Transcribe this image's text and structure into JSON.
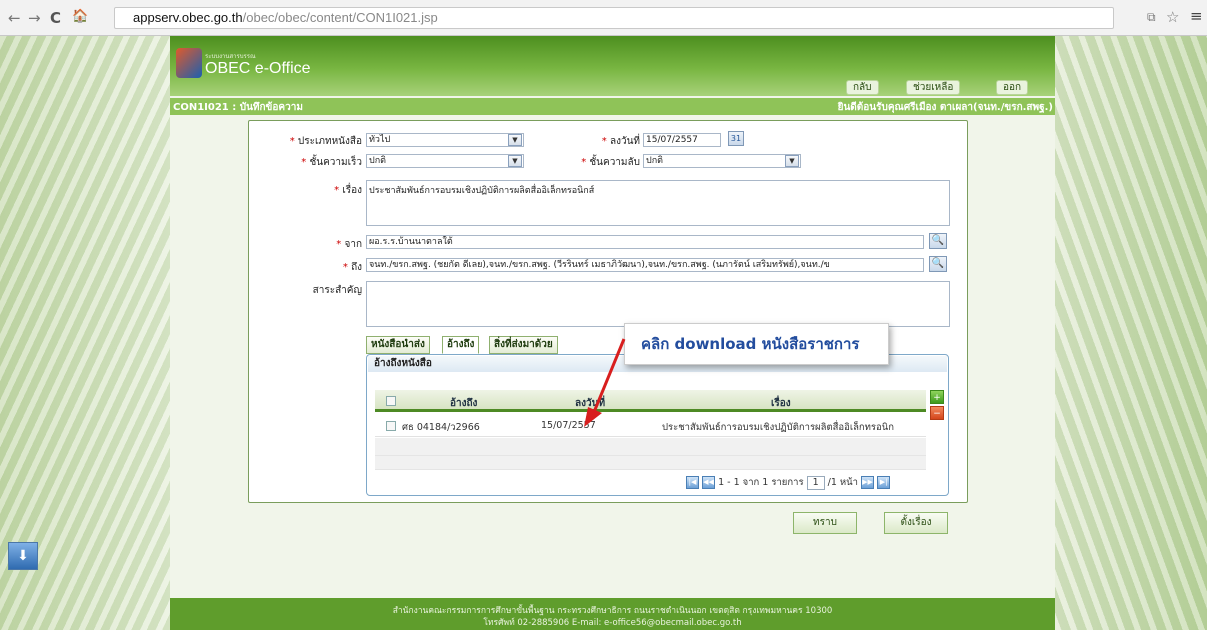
{
  "browser": {
    "url_host": "appserv.obec.go.th",
    "url_path": "/obec/obec/content/CON1I021.jsp",
    "back": "←",
    "forward": "→",
    "reload": "C",
    "home": "🏠",
    "menu": "≡",
    "star": "☆",
    "ext": "⧉"
  },
  "header": {
    "subtitle": "ระบบงานสารบรรณ",
    "title": "OBEC e-Office",
    "buttons": [
      "กลับ",
      "ช่วยเหลือ",
      "ออก"
    ]
  },
  "crumb": "CON1I021 : บันทึกข้อความ",
  "user_info": "ยินดีต้อนรับคุณศรีเมือง ตาเผลา(จนท./ขรก.สพฐ.)",
  "form": {
    "doc_type_label": "ประเภทหนังสือ",
    "doc_type_value": "ทั่วไป",
    "date_label": "ลงวันที่",
    "date_value": "15/07/2557",
    "urgency_label": "ชั้นความเร็ว",
    "urgency_value": "ปกติ",
    "secrecy_label": "ชั้นความลับ",
    "secrecy_value": "ปกติ",
    "subject_label": "เรื่อง",
    "subject_value": "ประชาสัมพันธ์การอบรมเชิงปฏิบัติการผลิตสื่ออิเล็กทรอนิกส์",
    "from_label": "จาก",
    "from_value": "ผอ.ร.ร.บ้านนาตาลใต้",
    "to_label": "ถึง",
    "to_value": "จนท./ขรก.สพฐ. (ชยกัต ดีเลย),จนท./ขรก.สพฐ. (วีรรินทร์ เมธาภิวัฒนา),จนท./ขรก.สพฐ. (นภารัตน์ เสริมทรัพย์),จนท./ข",
    "summary_label": "สาระสำคัญ"
  },
  "tabs": [
    "หนังสือนำส่ง",
    "อ้างถึง",
    "สิ่งที่ส่งมาด้วย"
  ],
  "grid": {
    "title": "อ้างถึงหนังสือ",
    "columns": [
      "อ้างถึง",
      "ลงวันที่",
      "เรื่อง"
    ],
    "rows": [
      {
        "ref": "ศธ 04184/ว2966",
        "date": "15/07/2557",
        "subject": "ประชาสัมพันธ์การอบรมเชิงปฏิบัติการผลิตสื่ออิเล็กทรอนิก"
      }
    ],
    "pager_text": "1 - 1 จาก 1 รายการ",
    "page": "1",
    "page_total": "/1 หน้า"
  },
  "callout": "คลิก download หนังสือราชการ",
  "actions": [
    "ทราบ",
    "ตั้งเรื่อง"
  ],
  "footer": {
    "line1": "สำนักงานคณะกรรมการการศึกษาขั้นพื้นฐาน กระทรวงศึกษาธิการ ถนนราชดำเนินนอก เขตดุสิต กรุงเทพมหานคร 10300",
    "line2": "โทรศัพท์ 02-2885906 E-mail: e-office56@obecmail.obec.go.th"
  },
  "colors": {
    "header_green": "#4d8f1f",
    "crumb_green": "#8fc358",
    "callout_blue": "#234d9e",
    "arrow_red": "#d81e1e"
  }
}
